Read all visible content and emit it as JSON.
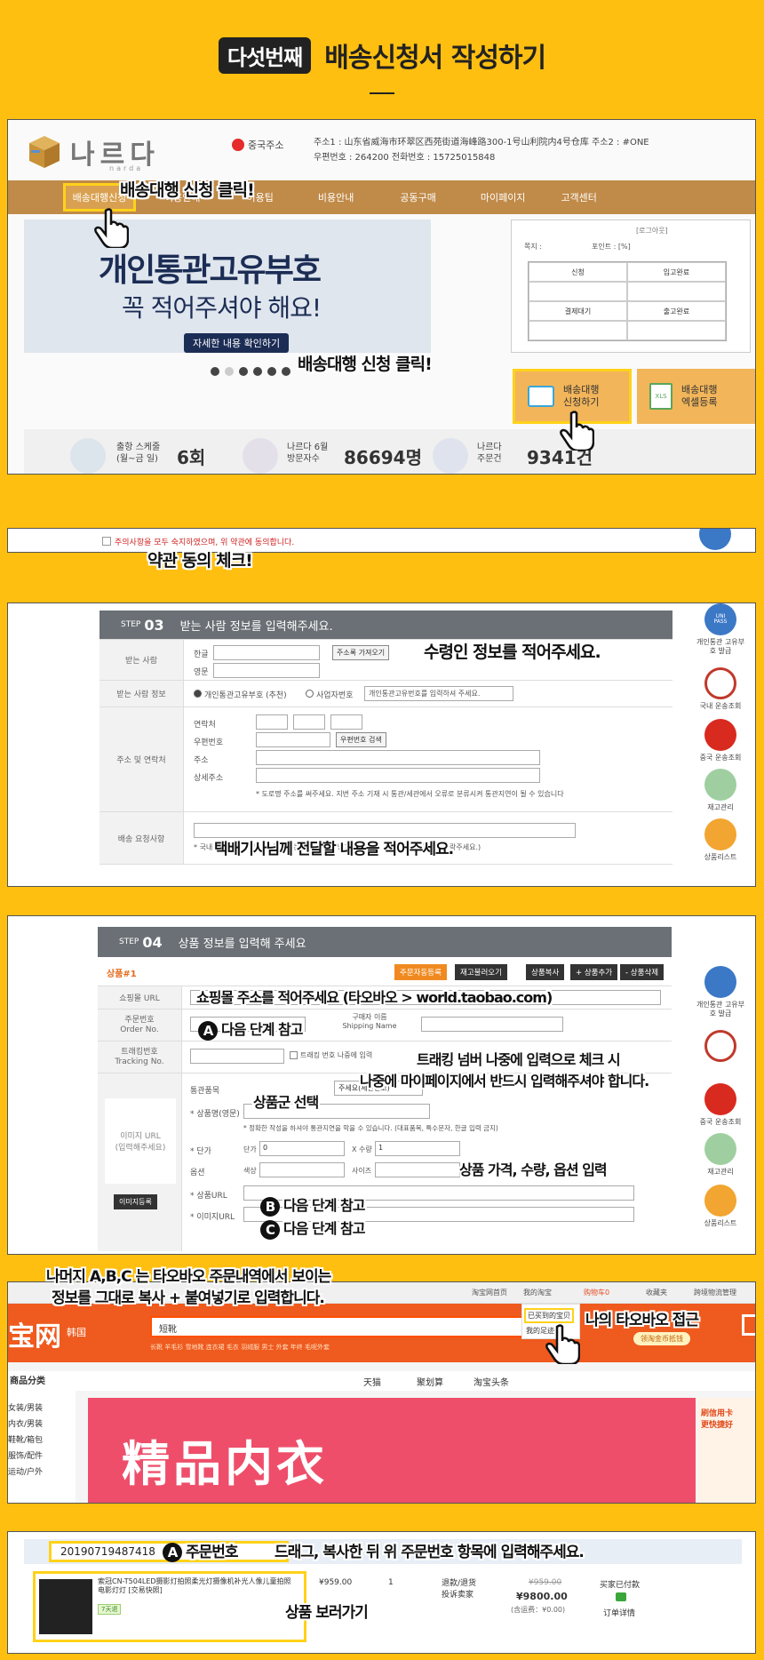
{
  "header": {
    "badge": "다섯번째",
    "title": "배송신청서 작성하기"
  },
  "panel1": {
    "logo_text": "나르다",
    "logo_sub": "narda",
    "china_addr_label": "중국주소",
    "addr_line1": "주소1 : 山东省威海市环翠区西苑街道海峰路300-1号山利院内4号仓库   주소2 : #ONE",
    "addr_line2": "우편번호 : 264200     전화번호 : 15725015848",
    "nav": [
      "배송대행신청",
      "이용안내",
      "이용팁",
      "비용안내",
      "공동구매",
      "마이페이지",
      "고객센터"
    ],
    "banner_title": "개인통관고유부호",
    "banner_sub": "꼭 적어주셔야 해요!",
    "banner_btn": "자세한 내용 확인하기",
    "logout": "[로그아웃]",
    "status_left": "쪽지 :",
    "status_right": "포인트 : [%]",
    "status_cells": [
      "신청",
      "입고완료",
      "",
      "",
      "결제대기",
      "출고완료",
      "",
      ""
    ],
    "apply_btn": "배송대행\n신청하기",
    "excel_btn": "배송대행\n엑셀등록",
    "stats": [
      {
        "label": "출항 스케줄\n(월~금 일)",
        "value": "6회"
      },
      {
        "label": "나르다 6월\n방문자수",
        "value": "86694명"
      },
      {
        "label": "나르다\n주문건",
        "value": "9341건"
      }
    ],
    "callout_top": "배송대행 신청 클릭!",
    "callout_bottom": "배송대행 신청 클릭!"
  },
  "panel2": {
    "agree_text": "주의사항을 모두 숙지하였으며, 위 약관에 동의합니다.",
    "callout": "약관 동의 체크!"
  },
  "panel3": {
    "step": "STEP",
    "step_num": "03",
    "title": "받는 사람 정보를 입력해주세요.",
    "r_label1": "받는 사람",
    "name_ko": "한글",
    "name_en": "영문",
    "addr_book_btn": "주소록 가져오기",
    "r_label2": "받는 사람 정보",
    "radio1": "개인통관고유부호 (추천)",
    "radio2": "사업자번호",
    "customs_placeholder": "개인통관고유번호를 입력하셔 주세요.",
    "r_label3": "주소 및 연락처",
    "contact": "연락처",
    "zip": "우편번호",
    "zip_btn": "우편번호 검색",
    "address": "주소",
    "address_detail": "상세주소",
    "addr_note": "* 도로명 주소를 써주세요. 지번 주소 기재 시 통관/세관에서 오류로 분류시켜 통관지연이 될 수 있습니다",
    "r_label4": "배송 요청사항",
    "req_note": "* 국내 배송기사 분께 전달하고 하는 요청사항을 남겨주세요(예: 부재 시 휴대폰으로 연락주세요.)",
    "callout_receiver": "수령인 정보를 적어주세요.",
    "callout_request": "택배기사님께 전달할 내용을 적어주세요."
  },
  "panel4": {
    "step": "STEP",
    "step_num": "04",
    "title": "상품 정보를 입력해 주세요",
    "product_tag": "상품#1",
    "tab_btns": [
      "주문자동등록",
      "재고불러오기",
      "상품복사",
      "+ 상품추가",
      "- 상품삭제"
    ],
    "mall_url": "쇼핑몰 URL",
    "order_no": "주문번호\nOrder No.",
    "buyer_name": "구매자 이름\nShipping Name",
    "tracking": "트래킹번호\nTracking No.",
    "tracking_check": "트래킹 번호 나중에 입력",
    "image_url": "이미지 URL\n(입력해주세요)",
    "image_btn": "이미지등록",
    "customs_item": "통관품목",
    "customs_select": "주세요(세관신고)",
    "product_name": "* 상품명(영문)",
    "product_note": "* 정확한 작성을 하셔야 통관지연을 막을 수 있습니다. (대표품목, 특수문자, 한글 입력 금지)",
    "price": "* 단가",
    "price_label": "단가",
    "price_val": "0",
    "qty_label": "X 수량",
    "qty_val": "1",
    "option": "옵션",
    "color": "색상",
    "size": "사이즈",
    "product_url": "* 상품URL",
    "image_url2": "* 이미지URL",
    "c_mall": "쇼핑몰 주소를 적어주세요 (타오바오 > world.taobao.com)",
    "c_order": "다음 단계 참고",
    "c_order_mark": "A",
    "c_tracking1": "트래킹 넘버 나중에 입력으로 체크 시",
    "c_tracking2": "나중에 마이페이지에서 반드시 입력해주셔야 합니다.",
    "c_group": "상품군 선택",
    "c_price": "상품 가격, 수량, 옵션 입력",
    "c_b": "다음 단계 참고",
    "c_b_mark": "B",
    "c_c": "다음 단계 참고",
    "c_c_mark": "C"
  },
  "side_icons": [
    "개인통관 고유부호 발급",
    "국내 운송조회",
    "중국 운송조회",
    "재고관리",
    "상품리스트"
  ],
  "side_uni": "UNI\nPASS",
  "panel5": {
    "callout_top1": "나머지 A,B,C 는 타오바오 주문내역에서 보이는",
    "callout_top2": "정보를 그대로 복사 + 붙여넣기로 입력합니다.",
    "topbar": [
      "淘宝网首页",
      "我的淘宝",
      "购物车0",
      "收藏夹",
      "跨境物流管理"
    ],
    "logo": "宝网",
    "logo_region": "韩国",
    "search_placeholder": "短靴",
    "search_hot": "长靴  羊毛衫  雪地靴  连衣裙  毛衣  羽绒服  男士 外套  年终  毛呢外套",
    "dropdown": [
      "已买到的宝贝",
      "我的足迹"
    ],
    "callout_taobao": "나의 타오바오 접근",
    "category_head": "商品分类",
    "categories": [
      "女装/男装",
      "内衣/男装",
      "鞋靴/箱包",
      "服饰/配件",
      "运动/户外"
    ],
    "tabs": [
      "天猫",
      "聚划算",
      "淘宝头条"
    ],
    "banner": "精品内衣",
    "credit": "刷信用卡\n更快捷好",
    "coupon": "领淘金币抵钱"
  },
  "panel6": {
    "order_number": "20190719487418",
    "mark": "A",
    "order_label": "주문번호",
    "callout_drag": "드래그, 복사한 뒤 위 주문번호 항목에 입력해주세요.",
    "product_title": "索冠CN-T504LED摄影灯拍照柔光灯摄像机补光人像儿童拍照电影灯灯 [交易快照]",
    "product_badge": "7天退",
    "price": "¥959.00",
    "qty": "1",
    "status1": "退款/退货\n投诉卖家",
    "price_old": "¥959.00",
    "price_paid": "¥9800.00",
    "shipping": "(含运费：¥0.00)",
    "trade": "买家已付款",
    "detail": "订单详情",
    "callout_view": "상품 보러가기"
  }
}
